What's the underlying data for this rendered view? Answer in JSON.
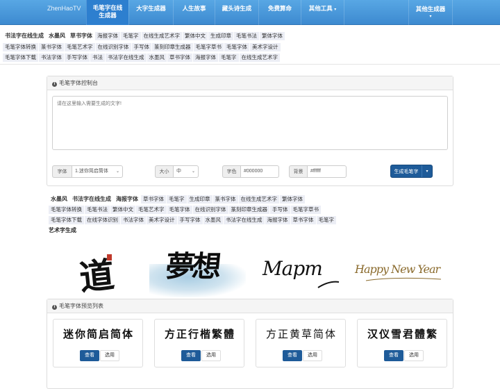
{
  "navbar": {
    "brand": "ZhenHaoTV",
    "items": [
      {
        "line1": "毛笔字在线",
        "line2": "生成器"
      },
      {
        "label": "大字生成器"
      },
      {
        "label": "人生故事"
      },
      {
        "label": "藏头诗生成"
      },
      {
        "label": "免费算命"
      },
      {
        "label": "其他工具"
      }
    ],
    "right_label": "其他生成器",
    "caret": "▾"
  },
  "top_tags": {
    "row1": [
      "书法字在线生成",
      "水墨风",
      "草书字体",
      "海报字体",
      "毛笔字",
      "在线生成艺术字",
      "繁体中文",
      "生成印章",
      "毛笔书法",
      "繁体字体"
    ],
    "row2": [
      "毛笔字体转换",
      "篆书字体",
      "毛笔艺术字",
      "在线识别字体",
      "手写体",
      "篆刻印章生成器",
      "毛笔字草书",
      "毛笔字体",
      "美术字设计"
    ],
    "row3": [
      "毛笔字体下载",
      "书法字体",
      "手写字体",
      "书法",
      "书法字在线生成",
      "水墨风",
      "草书字体",
      "海报字体",
      "毛笔字",
      "在线生成艺术字"
    ]
  },
  "control_panel": {
    "title": "毛笔字体控制台",
    "textarea_placeholder": "请在这里输入需要生成的文字!",
    "font_label": "字体",
    "font_value": "1.迷你简启筒体",
    "size_label": "大小",
    "size_value": "中",
    "color_label": "字色",
    "color_value": "#000000",
    "bg_label": "背景",
    "bg_value": "#ffffff",
    "generate_label": "生成毛笔字",
    "arrow": "▾"
  },
  "mid_tags": {
    "row1": [
      "水墨风",
      "书法字在线生成",
      "海报字体",
      "草书字体",
      "毛笔字",
      "生成印章",
      "篆书字体",
      "在线生成艺术字",
      "繁体字体"
    ],
    "row2": [
      "毛笔字体转换",
      "毛笔书法",
      "繁体中文",
      "毛笔艺术字",
      "毛笔字体",
      "在线识别字体",
      "篆刻印章生成器",
      "手写体",
      "毛笔字草书"
    ],
    "row3": [
      "毛笔字体下载",
      "在线字体识别",
      "书法字体",
      "美术字设计",
      "手写字体",
      "水墨风",
      "书法字在线生成",
      "海报字体",
      "草书字体",
      "毛笔字"
    ]
  },
  "samples": {
    "title": "艺术字生成",
    "s1_char": "道",
    "s2_text": "夢想",
    "s3_text": "Mapm",
    "s4_text": "Happy New Year"
  },
  "preview_panel": {
    "title": "毛笔字体预览列表",
    "cards": [
      {
        "text": "迷你简启简体"
      },
      {
        "text": "方正行楷繁體"
      },
      {
        "text": "方正黄草简体"
      },
      {
        "text": "汉仪雪君體繁"
      }
    ],
    "view_label": "查看",
    "select_label": "选用"
  },
  "colors": {
    "nav": "#3d8ad0",
    "button": "#1e5b99",
    "seal": "#c0392b",
    "wash": "#bcd9ea",
    "gold": "#8a6a2c"
  }
}
